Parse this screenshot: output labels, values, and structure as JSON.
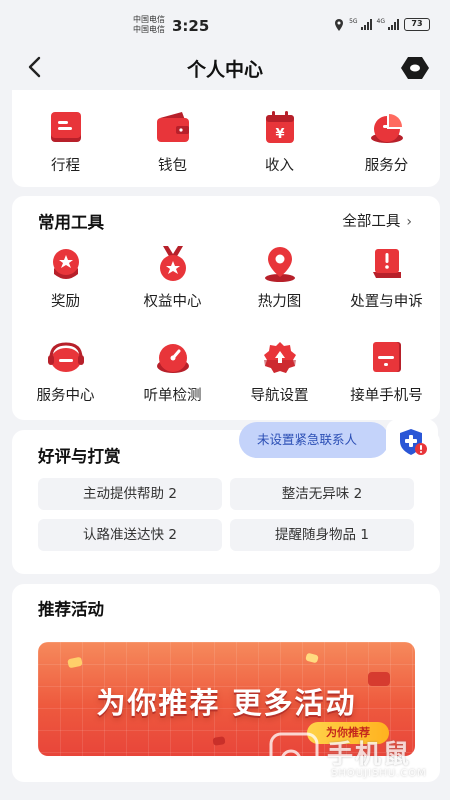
{
  "status_bar": {
    "carrier_1": "中国电信",
    "carrier_2": "中国电信",
    "time": "3:25",
    "net_1": "5G",
    "net_2": "4G",
    "battery": "73"
  },
  "header": {
    "title": "个人中心",
    "back_icon": "chevron-left-icon",
    "settings_icon": "hexagon-settings-icon"
  },
  "top_row": [
    {
      "label": "行程",
      "icon": "itinerary-icon"
    },
    {
      "label": "钱包",
      "icon": "wallet-icon"
    },
    {
      "label": "收入",
      "icon": "income-icon"
    },
    {
      "label": "服务分",
      "icon": "service-score-icon"
    }
  ],
  "tools": {
    "title": "常用工具",
    "all_link": "全部工具",
    "items": [
      {
        "label": "奖励",
        "icon": "reward-icon"
      },
      {
        "label": "权益中心",
        "icon": "benefits-medal-icon"
      },
      {
        "label": "热力图",
        "icon": "heatmap-pin-icon"
      },
      {
        "label": "处置与申诉",
        "icon": "appeal-icon"
      },
      {
        "label": "服务中心",
        "icon": "headset-icon"
      },
      {
        "label": "听单检测",
        "icon": "order-check-gauge-icon"
      },
      {
        "label": "导航设置",
        "icon": "navigation-gear-icon"
      },
      {
        "label": "接单手机号",
        "icon": "phone-number-icon"
      }
    ]
  },
  "emergency": {
    "label": "未设置紧急联系人",
    "icon": "shield-alert-icon"
  },
  "reviews": {
    "title": "好评与打赏",
    "tags": [
      "主动提供帮助 2",
      "整洁无异味 2",
      "认路准送达快 2",
      "提醒随身物品 1"
    ]
  },
  "activity": {
    "title": "推荐活动",
    "banner_text": "为你推荐  更多活动",
    "banner_badge": "为你推荐"
  },
  "watermark": {
    "main": "手机鼠",
    "sub": "SHOUJISHU.COM"
  },
  "colors": {
    "accent_red": "#e8353a",
    "dark_red": "#b7202a",
    "page_bg": "#f2f3f6",
    "pill_blue": "#c4d3fa"
  }
}
